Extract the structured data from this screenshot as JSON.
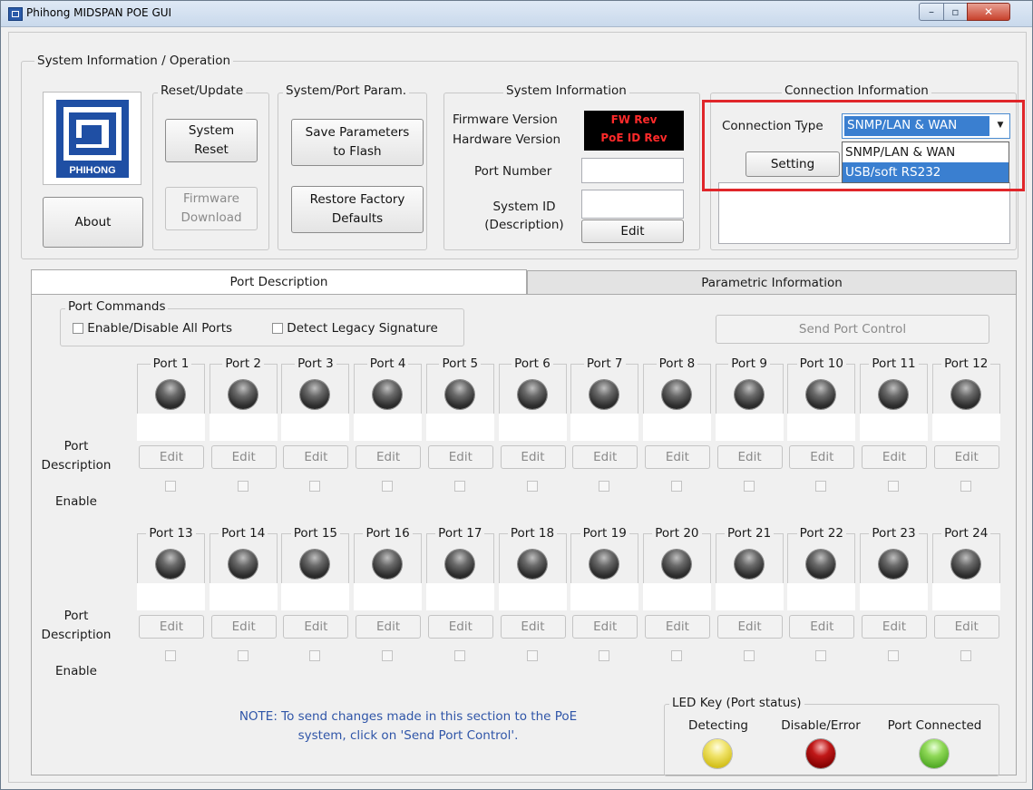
{
  "window": {
    "title": "Phihong MIDSPAN POE GUI",
    "min_glyph": "–",
    "max_glyph": "▫",
    "close_glyph": "✕"
  },
  "system_group": {
    "title": "System Information / Operation",
    "logo_text": "PHIHONG",
    "about_label": "About"
  },
  "reset_update": {
    "title": "Reset/Update",
    "system_reset_label": "System\nReset",
    "firmware_download_label": "Firmware\nDownload"
  },
  "sys_port_param": {
    "title": "System/Port Param.",
    "save_label": "Save Parameters\nto Flash",
    "restore_label": "Restore Factory\nDefaults"
  },
  "system_info": {
    "title": "System Information",
    "firmware_label": "Firmware Version",
    "hardware_label": "Hardware Version",
    "fw_value": "FW Rev",
    "hw_value": "PoE ID Rev",
    "port_number_label": "Port Number",
    "system_id_label": "System ID\n(Description)",
    "edit_label": "Edit"
  },
  "connection": {
    "title": "Connection Information",
    "type_label": "Connection Type",
    "selected": "SNMP/LAN & WAN",
    "options": [
      "SNMP/LAN & WAN",
      "USB/soft RS232"
    ],
    "highlighted_option": "USB/soft RS232",
    "setting_label": "Setting"
  },
  "tabs": {
    "port_description": "Port Description",
    "parametric": "Parametric Information"
  },
  "port_commands": {
    "title": "Port Commands",
    "enable_all": "Enable/Disable All Ports",
    "legacy": "Detect Legacy Signature",
    "send_label": "Send Port Control"
  },
  "row_labels": {
    "port_description": "Port\nDescription",
    "enable": "Enable"
  },
  "ports_row1": [
    "Port 1",
    "Port 2",
    "Port 3",
    "Port 4",
    "Port 5",
    "Port 6",
    "Port 7",
    "Port 8",
    "Port 9",
    "Port 10",
    "Port 11",
    "Port 12"
  ],
  "ports_row2": [
    "Port 13",
    "Port 14",
    "Port 15",
    "Port 16",
    "Port 17",
    "Port 18",
    "Port 19",
    "Port 20",
    "Port 21",
    "Port 22",
    "Port 23",
    "Port 24"
  ],
  "edit_label": "Edit",
  "note": "NOTE: To send changes made in this section to the PoE\nsystem, click on 'Send Port Control'.",
  "led_key": {
    "title": "LED Key (Port status)",
    "detecting": "Detecting",
    "disable_error": "Disable/Error",
    "connected": "Port Connected"
  },
  "colors": {
    "highlight": "#e0262a",
    "note_text": "#2f55a8",
    "selection": "#3a7fd0"
  }
}
